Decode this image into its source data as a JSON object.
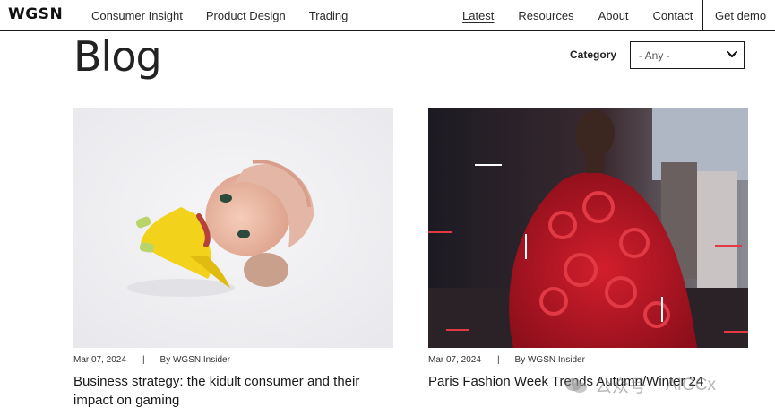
{
  "header": {
    "logo": "WGSN",
    "nav_left": [
      "Consumer Insight",
      "Product Design",
      "Trading"
    ],
    "nav_right": [
      "Latest",
      "Resources",
      "About",
      "Contact"
    ],
    "active": "Latest",
    "cta": "Get demo"
  },
  "page": {
    "title": "Blog",
    "category_label": "Category",
    "category_value": "- Any -"
  },
  "posts": [
    {
      "date": "Mar 07, 2024",
      "separator": "|",
      "author": "By WGSN Insider",
      "title": "Business strategy: the kidult consumer and their impact on gaming",
      "image": "person-yellow-outfit-photo"
    },
    {
      "date": "Mar 07, 2024",
      "separator": "|",
      "author": "By WGSN Insider",
      "title": "Paris Fashion Week Trends Autumn/Winter 24",
      "image": "red-knit-coat-runway-photo"
    }
  ],
  "watermark": {
    "text1": "公众号",
    "text2": "AIGCx"
  },
  "colors": {
    "text": "#1a1a1a",
    "border": "#1a1a1a",
    "accent_red": "#c8102e"
  }
}
